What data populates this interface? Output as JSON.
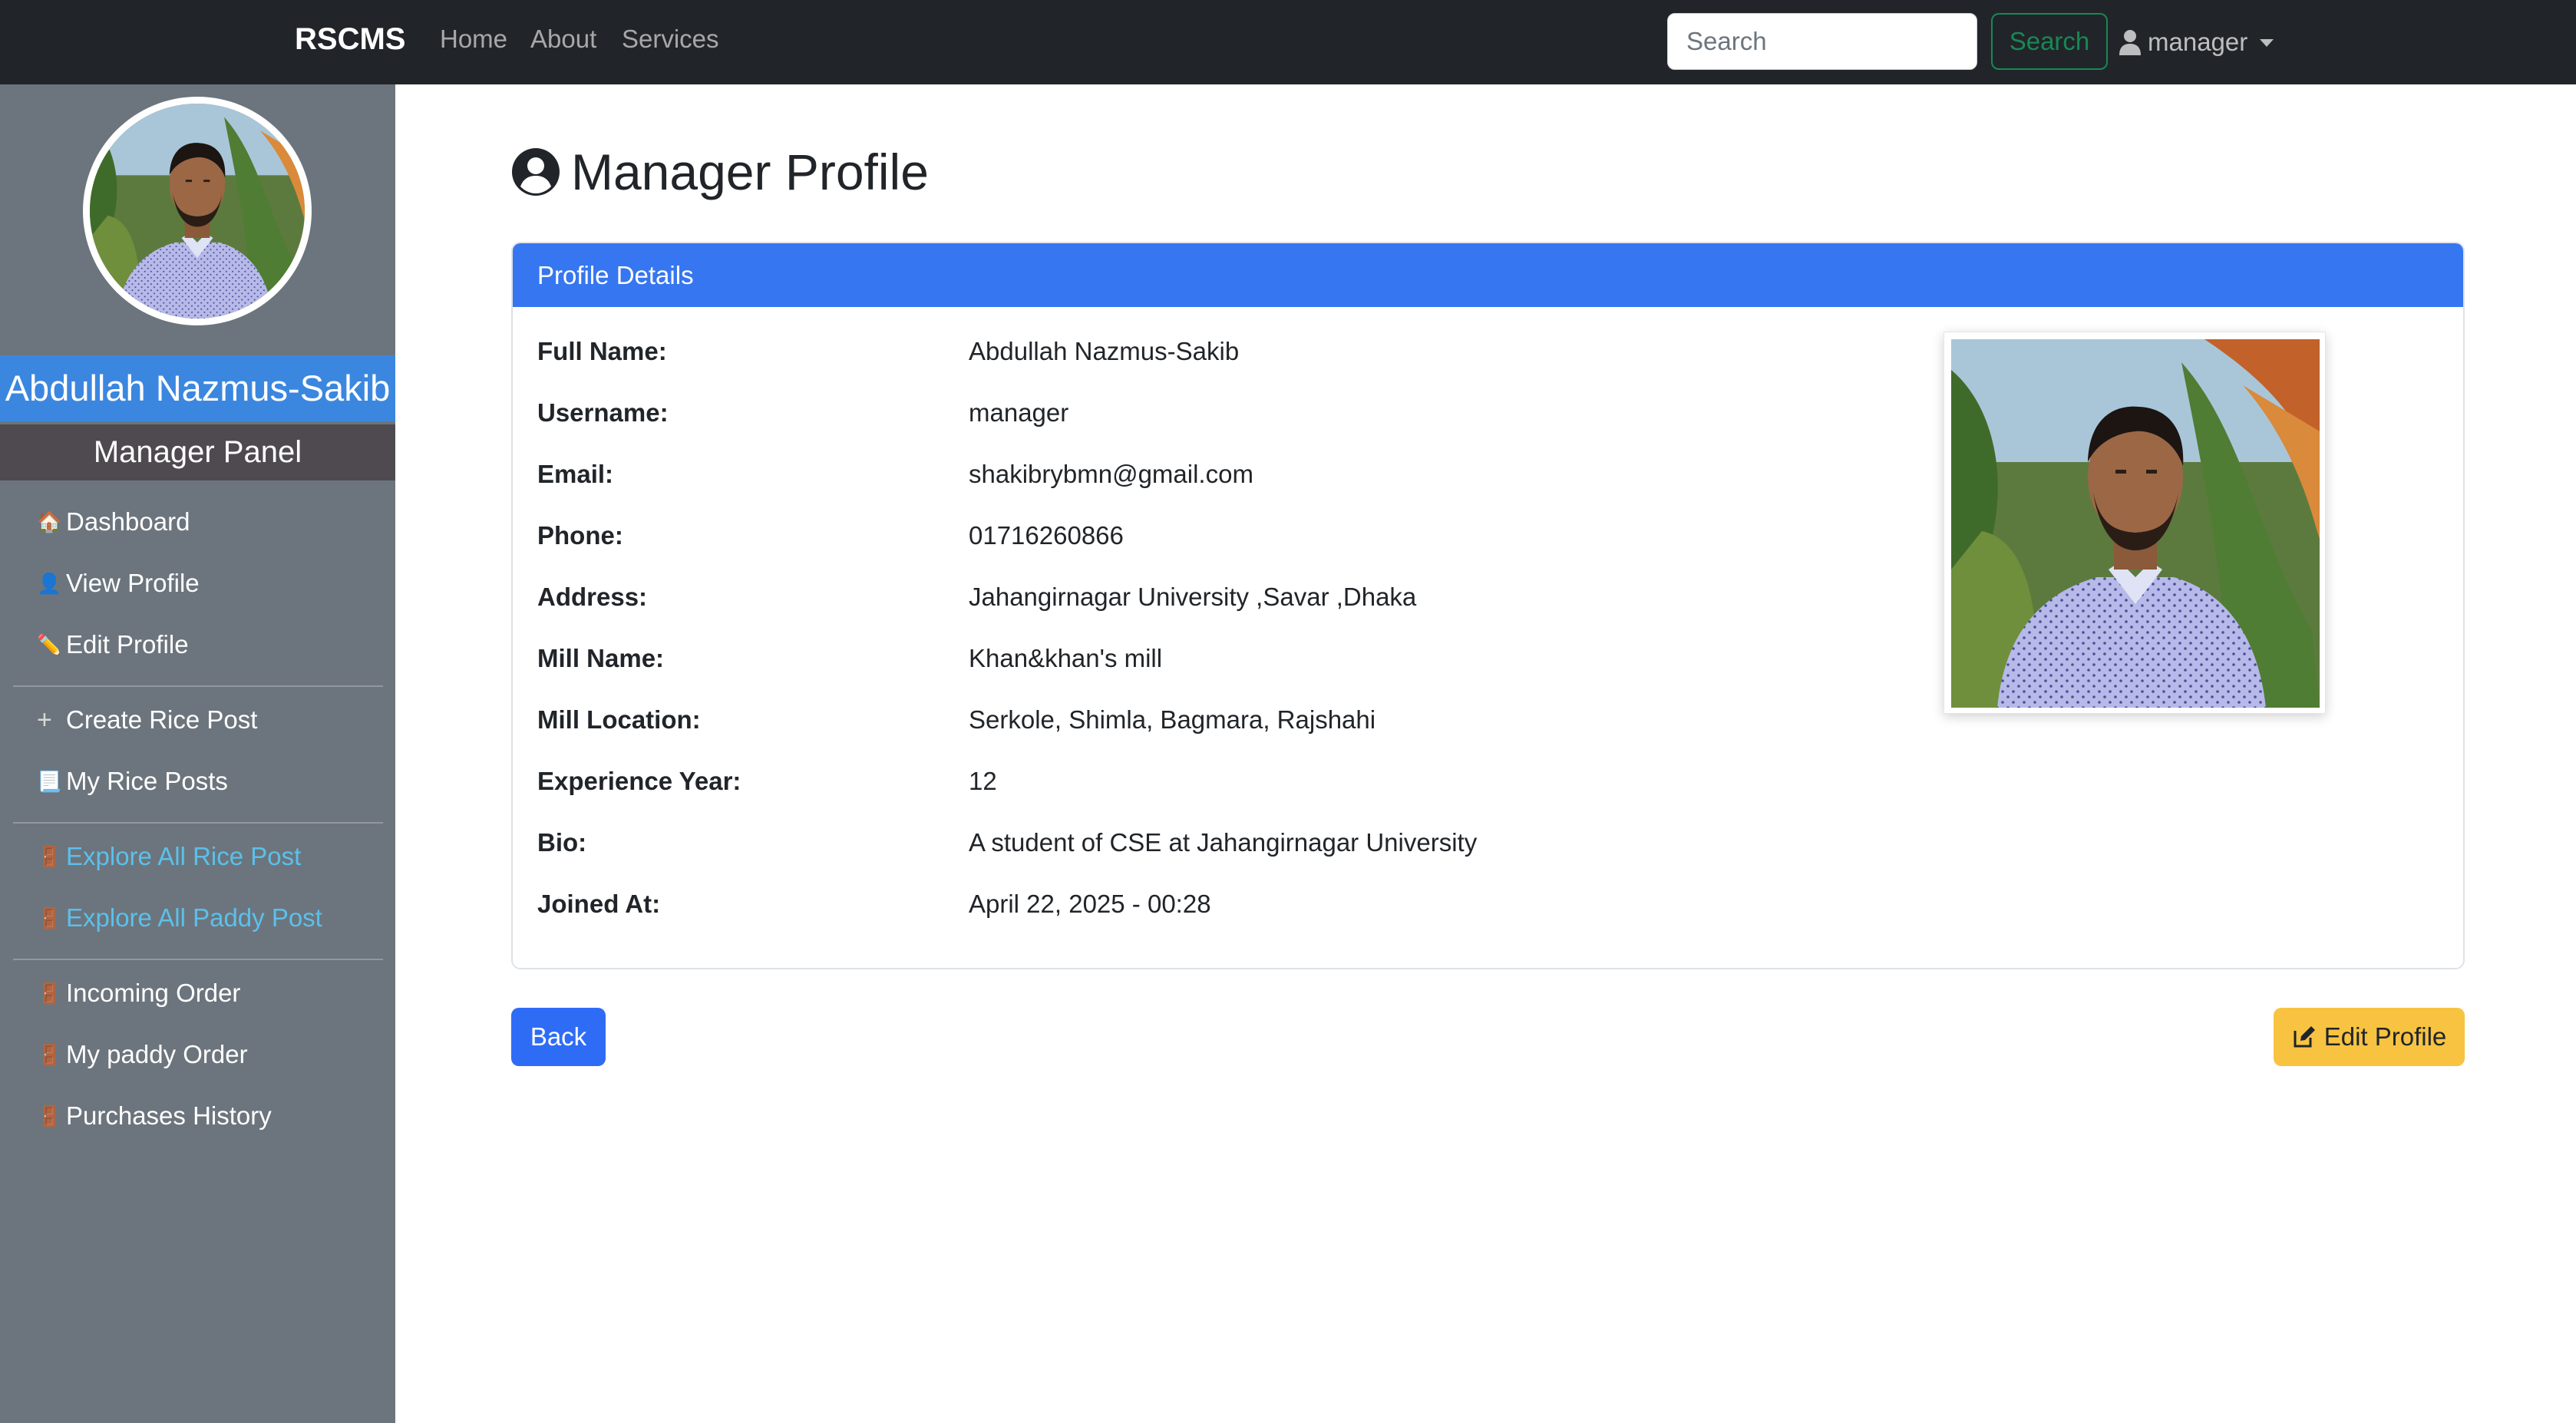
{
  "navbar": {
    "brand": "RSCMS",
    "links": [
      "Home",
      "About",
      "Services"
    ],
    "search_placeholder": "Search",
    "search_button": "Search",
    "user_label": "manager"
  },
  "sidebar": {
    "name": "Abdullah Nazmus-Sakib",
    "panel_title": "Manager Panel",
    "items": [
      {
        "icon": "house-icon",
        "label": "Dashboard"
      },
      {
        "icon": "person-icon",
        "label": "View Profile"
      },
      {
        "icon": "pencil-icon",
        "label": "Edit Profile"
      },
      {
        "icon": "plus-icon",
        "label": "Create Rice Post"
      },
      {
        "icon": "document-icon",
        "label": "My Rice Posts"
      },
      {
        "icon": "door-icon",
        "label": "Explore All Rice Post"
      },
      {
        "icon": "door-icon",
        "label": "Explore All Paddy Post"
      },
      {
        "icon": "door-icon",
        "label": "Incoming Order"
      },
      {
        "icon": "door-icon",
        "label": "My paddy Order"
      },
      {
        "icon": "door-icon",
        "label": "Purchases History"
      }
    ]
  },
  "main": {
    "title": "Manager Profile",
    "card_header": "Profile Details",
    "fields": [
      {
        "label": "Full Name:",
        "value": "Abdullah Nazmus-Sakib"
      },
      {
        "label": "Username:",
        "value": "manager"
      },
      {
        "label": "Email:",
        "value": "shakibrybmn@gmail.com"
      },
      {
        "label": "Phone:",
        "value": "01716260866"
      },
      {
        "label": "Address:",
        "value": "Jahangirnagar University ,Savar ,Dhaka"
      },
      {
        "label": "Mill Name:",
        "value": "Khan&khan's mill"
      },
      {
        "label": "Mill Location:",
        "value": "Serkole, Shimla, Bagmara, Rajshahi"
      },
      {
        "label": "Experience Year:",
        "value": "12"
      },
      {
        "label": "Bio:",
        "value": "A student of CSE at Jahangirnagar University"
      },
      {
        "label": "Joined At:",
        "value": "April 22, 2025 - 00:28"
      }
    ],
    "back_button": "Back",
    "edit_button": "Edit Profile"
  },
  "colors": {
    "navbar_bg": "#212529",
    "sidebar_bg": "#6c757d",
    "name_banner": "#3b87e0",
    "card_header": "#3676f0",
    "back_button": "#2f6cf6",
    "edit_button": "#f7c341",
    "search_button": "#198754",
    "sidebar_link": "#5bc0eb"
  }
}
